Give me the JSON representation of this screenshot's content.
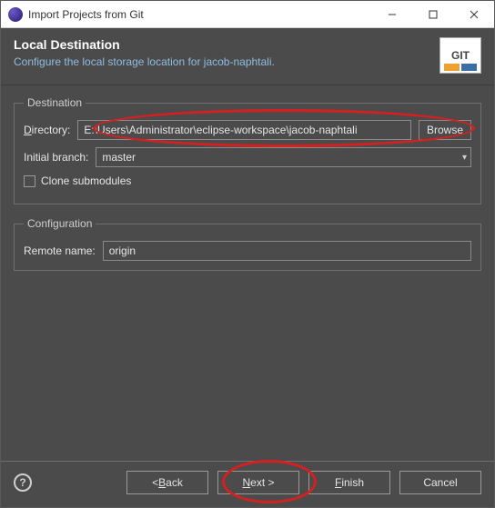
{
  "window": {
    "title": "Import Projects from Git"
  },
  "header": {
    "title": "Local Destination",
    "subtitle": "Configure the local storage location for jacob-naphtali.",
    "badge": "GIT"
  },
  "destination": {
    "legend": "Destination",
    "directory_label_pre": "D",
    "directory_label_post": "irectory:",
    "directory_value": "E:\\Users\\Administrator\\eclipse-workspace\\jacob-naphtali",
    "browse_pre": "B",
    "browse_post": "rowse",
    "initial_branch_label": "Initial branch:",
    "initial_branch_value": "master",
    "clone_submodules_label": "Clone submodules"
  },
  "configuration": {
    "legend": "Configuration",
    "remote_name_label": "Remote name:",
    "remote_name_value": "origin"
  },
  "buttons": {
    "back_pre": "< ",
    "back_ul": "B",
    "back_post": "ack",
    "next_ul": "N",
    "next_post": "ext >",
    "finish_ul": "F",
    "finish_post": "inish",
    "cancel": "Cancel"
  }
}
